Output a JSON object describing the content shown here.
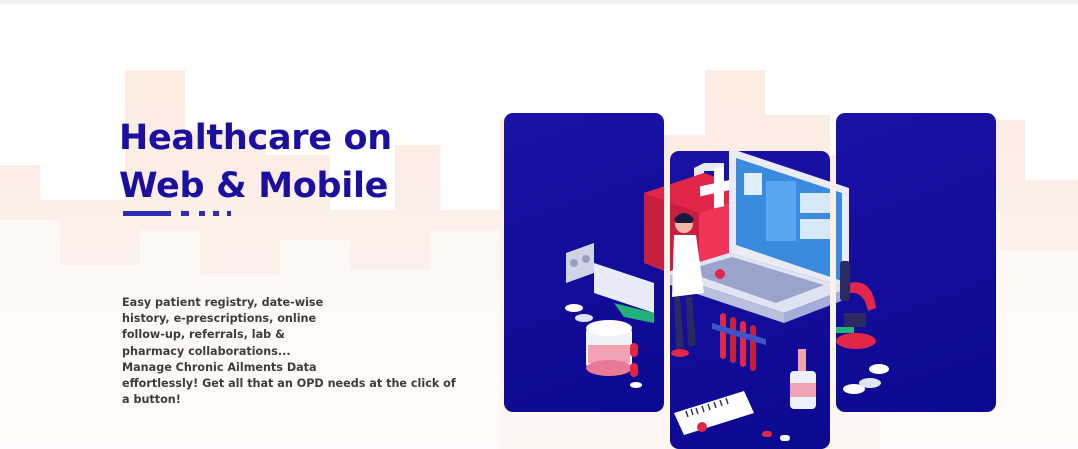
{
  "hero": {
    "title_line1": "Healthcare on",
    "title_line2": "Web & Mobile",
    "description_lines": [
      "Easy patient registry, date-wise",
      "history, e-prescriptions, online",
      "follow-up, referrals, lab &",
      "pharmacy collaborations...",
      "Manage Chronic Ailments Data",
      "effortlessly! Get all that an OPD needs at the click of",
      "a button!"
    ]
  },
  "colors": {
    "title": "#1b0fa0",
    "panel": "#12109c",
    "skyline": "#fbeee6",
    "accent_red": "#e1264a"
  },
  "icons": [
    "skyline-background",
    "laptop-icon",
    "first-aid-kit-icon",
    "doctor-figure",
    "microscope-icon",
    "pill-bottle-icon",
    "test-tubes-icon",
    "barcode-card-icon"
  ]
}
